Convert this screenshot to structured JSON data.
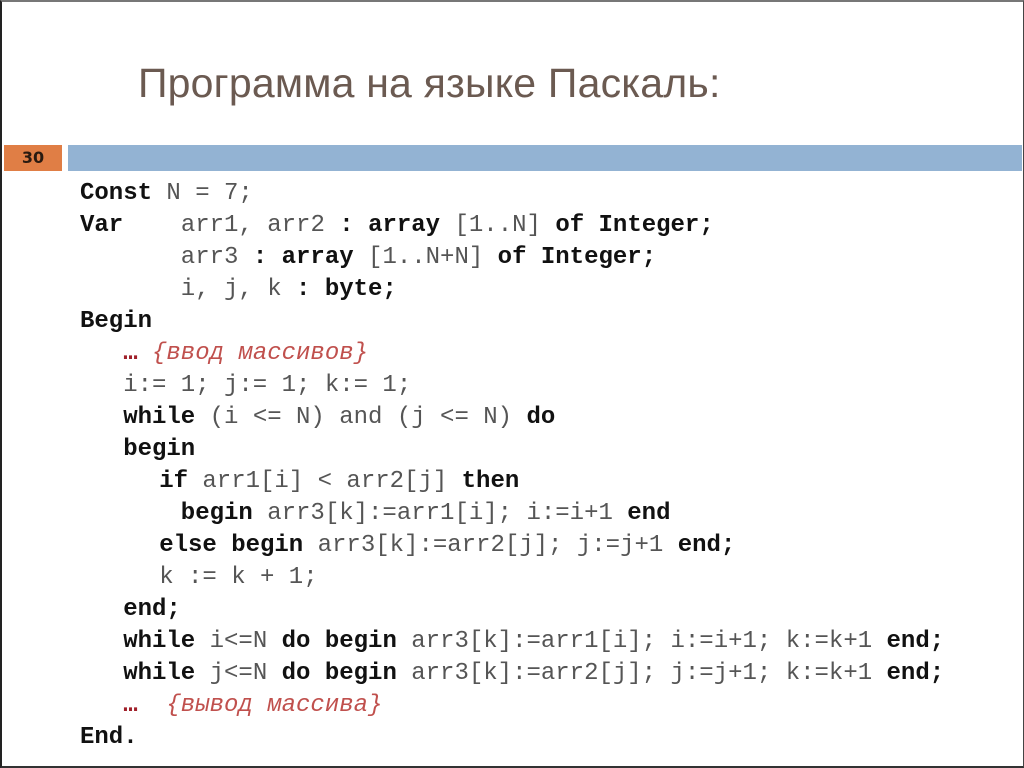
{
  "slide": {
    "title": "Программа на языке Паскаль:",
    "number": "30",
    "colors": {
      "number_box": "#e07e45",
      "band": "#93b3d3",
      "title": "#6b5a51",
      "comment": "#c0504d"
    }
  },
  "code": {
    "language": "Pascal",
    "lines": [
      {
        "indent": 0,
        "tokens": [
          [
            "k",
            "Const"
          ],
          [
            "t",
            " N = 7;"
          ]
        ]
      },
      {
        "indent": 0,
        "tokens": [
          [
            "k",
            "Var"
          ],
          [
            "t",
            "    arr1, arr2 "
          ],
          [
            "k",
            ": array"
          ],
          [
            "t",
            " [1..N] "
          ],
          [
            "k",
            "of Integer;"
          ]
        ]
      },
      {
        "indent": 7,
        "tokens": [
          [
            "t",
            "arr3 "
          ],
          [
            "k",
            ": array"
          ],
          [
            "t",
            " [1..N+N] "
          ],
          [
            "k",
            "of Integer;"
          ]
        ]
      },
      {
        "indent": 7,
        "tokens": [
          [
            "t",
            "i, j, k "
          ],
          [
            "k",
            ": byte;"
          ]
        ]
      },
      {
        "indent": 0,
        "tokens": [
          [
            "k",
            "Begin"
          ]
        ]
      },
      {
        "indent": 3,
        "tokens": [
          [
            "e",
            "…"
          ],
          [
            "c",
            " {ввод массивов}"
          ]
        ]
      },
      {
        "indent": 3,
        "tokens": [
          [
            "t",
            "i:= 1; j:= 1; k:= 1;"
          ]
        ]
      },
      {
        "indent": 3,
        "tokens": [
          [
            "k",
            "while"
          ],
          [
            "t",
            " (i <= N) and (j <= N) "
          ],
          [
            "k",
            "do"
          ]
        ]
      },
      {
        "indent": 3,
        "tokens": [
          [
            "k",
            "begin"
          ]
        ]
      },
      {
        "indent": 5.5,
        "tokens": [
          [
            "k",
            "if"
          ],
          [
            "t",
            " arr1[i] < arr2[j] "
          ],
          [
            "k",
            "then"
          ]
        ]
      },
      {
        "indent": 7,
        "tokens": [
          [
            "k",
            "begin"
          ],
          [
            "t",
            " arr3[k]:=arr1[i]; i:=i+1 "
          ],
          [
            "k",
            "end"
          ]
        ]
      },
      {
        "indent": 5.5,
        "tokens": [
          [
            "k",
            "else begin"
          ],
          [
            "t",
            " arr3[k]:=arr2[j]; j:=j+1 "
          ],
          [
            "k",
            "end;"
          ]
        ]
      },
      {
        "indent": 5.5,
        "tokens": [
          [
            "t",
            "k := k + 1;"
          ]
        ]
      },
      {
        "indent": 3,
        "tokens": [
          [
            "k",
            "end;"
          ]
        ]
      },
      {
        "indent": 3,
        "tokens": [
          [
            "k",
            "while"
          ],
          [
            "t",
            " i<=N "
          ],
          [
            "k",
            "do begin"
          ],
          [
            "t",
            " arr3[k]:=arr1[i]; i:=i+1; k:=k+1 "
          ],
          [
            "k",
            "end;"
          ]
        ]
      },
      {
        "indent": 3,
        "tokens": [
          [
            "k",
            "while"
          ],
          [
            "t",
            " j<=N "
          ],
          [
            "k",
            "do begin"
          ],
          [
            "t",
            " arr3[k]:=arr2[j]; j:=j+1; k:=k+1 "
          ],
          [
            "k",
            "end;"
          ]
        ]
      },
      {
        "indent": 3,
        "tokens": [
          [
            "e",
            "…"
          ],
          [
            "c",
            "  {вывод массива}"
          ]
        ]
      },
      {
        "indent": 0,
        "tokens": [
          [
            "k",
            "End."
          ]
        ]
      }
    ]
  }
}
